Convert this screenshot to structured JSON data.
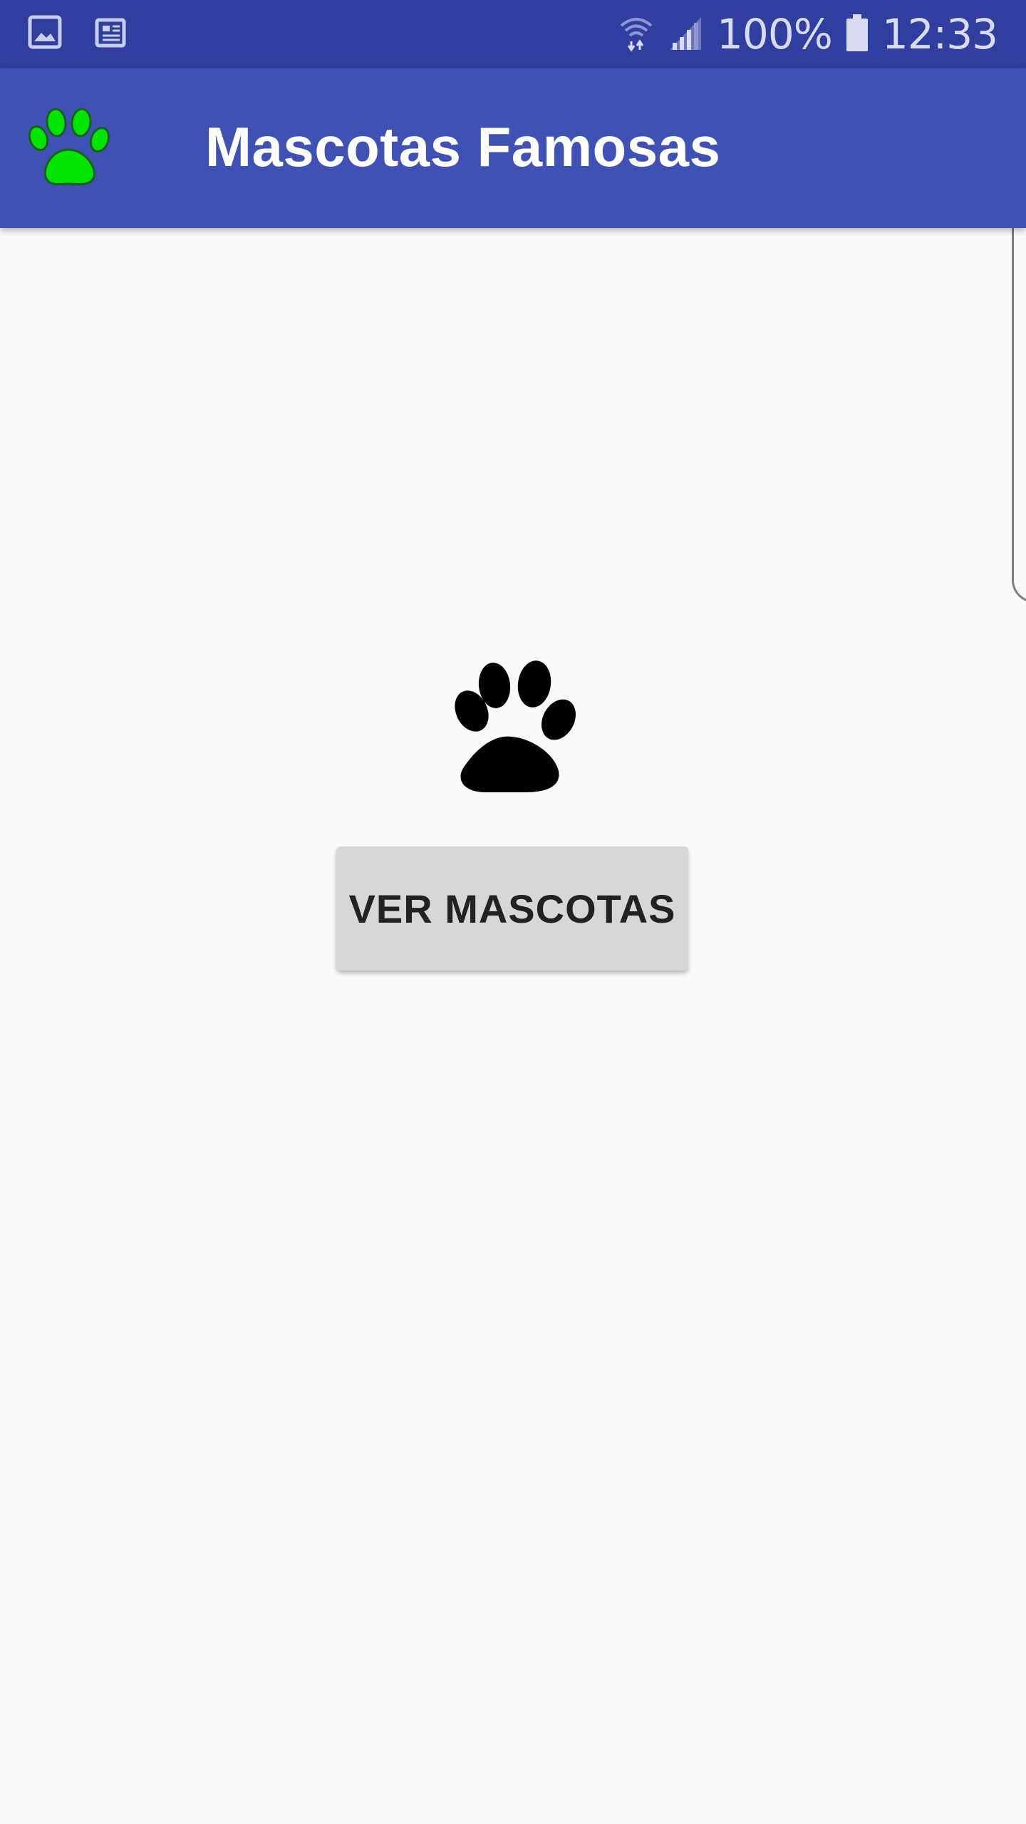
{
  "status_bar": {
    "left_icons": [
      "gallery-icon",
      "news-icon"
    ],
    "right_icons": [
      "wifi-icon",
      "signal-icon",
      "battery-icon"
    ],
    "battery": "100%",
    "time": "12:33",
    "background": "#303f9f"
  },
  "app_bar": {
    "title": "Mascotas Famosas",
    "logo_icon": "green-paw-icon",
    "background": "#3f51b5",
    "logo_color": "#00e400"
  },
  "main": {
    "image_icon": "black-paw-icon",
    "button_label": "VER MASCOTAS",
    "button_color": "#d6d7d7"
  }
}
